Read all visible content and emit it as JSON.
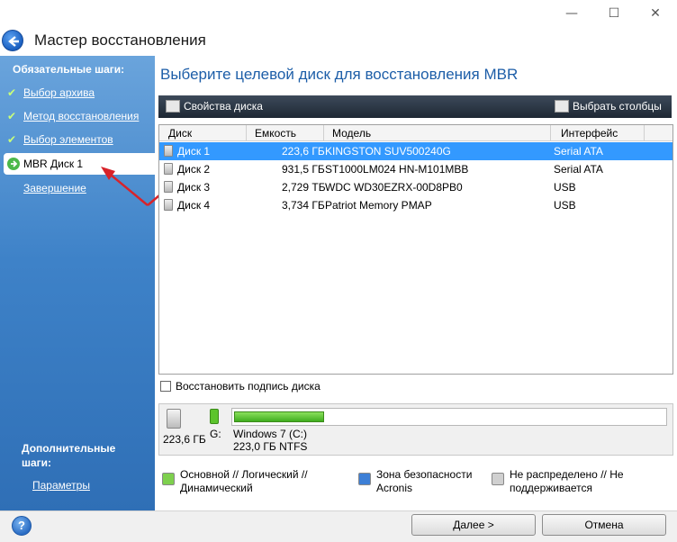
{
  "window": {
    "minimize": "—",
    "maximize": "☐",
    "close": "✕"
  },
  "wizard_title": "Мастер восстановления",
  "sidebar": {
    "required_heading": "Обязательные шаги:",
    "steps": [
      {
        "label": "Выбор архива",
        "done": true
      },
      {
        "label": "Метод восстановления",
        "done": true
      },
      {
        "label": "Выбор элементов",
        "done": true
      }
    ],
    "current_step": "MBR Диск 1",
    "finish_step": "Завершение",
    "additional_heading": "Дополнительные шаги:",
    "params": "Параметры"
  },
  "main": {
    "title": "Выберите целевой диск для восстановления MBR",
    "toolbar": {
      "props": "Свойства диска",
      "columns": "Выбрать столбцы"
    },
    "columns": [
      "Диск",
      "Емкость",
      "Модель",
      "Интерфейс"
    ],
    "rows": [
      {
        "disk": "Диск 1",
        "capacity": "223,6 ГБ",
        "model": "KINGSTON SUV500240G",
        "iface": "Serial ATA",
        "selected": true
      },
      {
        "disk": "Диск 2",
        "capacity": "931,5 ГБ",
        "model": "ST1000LM024 HN-M101MBB",
        "iface": "Serial ATA"
      },
      {
        "disk": "Диск 3",
        "capacity": "2,729 ТБ",
        "model": "WDC WD30EZRX-00D8PB0",
        "iface": "USB"
      },
      {
        "disk": "Диск 4",
        "capacity": "3,734 ГБ",
        "model": "Patriot Memory PMAP",
        "iface": "USB"
      }
    ],
    "restore_signature": "Восстановить подпись диска",
    "partition": {
      "disk_size": "223,6 ГБ",
      "letter": "G:",
      "name": "Windows 7 (C:)",
      "info": "223,0 ГБ  NTFS",
      "used_fraction": 0.21
    },
    "legend": [
      {
        "label1": "Основной // Логический //",
        "label2": "Динамический",
        "color": "#7ed04e"
      },
      {
        "label1": "Зона безопасности",
        "label2": "Acronis",
        "color": "#3d7fd6"
      },
      {
        "label1": "Не распределено // Не",
        "label2": "поддерживается",
        "color": "#d0d0d0"
      }
    ]
  },
  "footer": {
    "help": "?",
    "next": "Далее >",
    "cancel": "Отмена"
  }
}
